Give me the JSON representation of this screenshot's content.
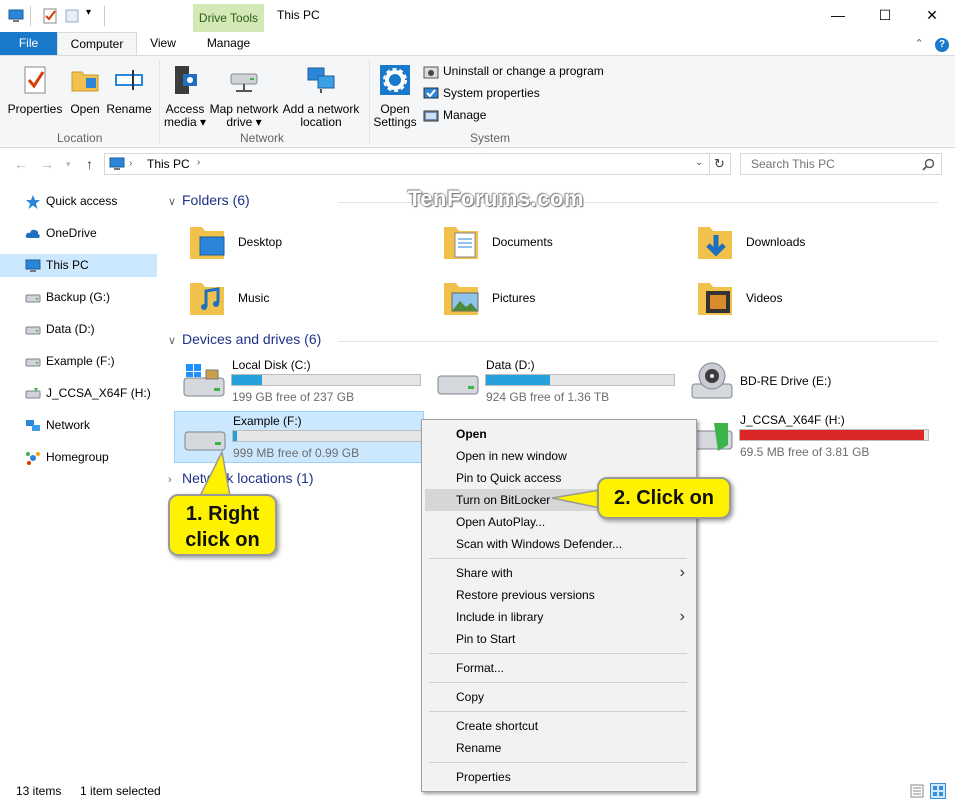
{
  "window": {
    "title": "This PC",
    "contextual_tab": "Drive Tools",
    "minimize": "—",
    "maximize": "☐",
    "close": "✕"
  },
  "tabs": {
    "file": "File",
    "computer": "Computer",
    "view": "View",
    "manage": "Manage"
  },
  "ribbon": {
    "location": {
      "label": "Location",
      "properties": "Properties",
      "open": "Open",
      "rename": "Rename"
    },
    "network": {
      "label": "Network",
      "access_media_1": "Access",
      "access_media_2": "media ▾",
      "map_drive_1": "Map network",
      "map_drive_2": "drive ▾",
      "add_location_1": "Add a network",
      "add_location_2": "location"
    },
    "system": {
      "label": "System",
      "open_settings_1": "Open",
      "open_settings_2": "Settings",
      "uninstall": "Uninstall or change a program",
      "system_properties": "System properties",
      "manage": "Manage"
    }
  },
  "address": {
    "path": "This PC",
    "search_placeholder": "Search This PC"
  },
  "nav": {
    "items": [
      {
        "label": "Quick access"
      },
      {
        "label": "OneDrive"
      },
      {
        "label": "This PC"
      },
      {
        "label": "Backup (G:)"
      },
      {
        "label": "Data (D:)"
      },
      {
        "label": "Example (F:)"
      },
      {
        "label": "J_CCSA_X64F (H:)"
      },
      {
        "label": "Network"
      },
      {
        "label": "Homegroup"
      }
    ]
  },
  "watermark": "TenForums.com",
  "folders": {
    "header": "Folders (6)",
    "items": [
      {
        "label": "Desktop"
      },
      {
        "label": "Documents"
      },
      {
        "label": "Downloads"
      },
      {
        "label": "Music"
      },
      {
        "label": "Pictures"
      },
      {
        "label": "Videos"
      }
    ]
  },
  "drives": {
    "header": "Devices and drives (6)",
    "items": [
      {
        "name": "Local Disk (C:)",
        "free": "199 GB free of 237 GB",
        "used_fraction": 0.16
      },
      {
        "name": "Data (D:)",
        "free": "924 GB free of 1.36 TB",
        "used_fraction": 0.34
      },
      {
        "name": "BD-RE Drive (E:)",
        "free": "",
        "used_fraction": null
      },
      {
        "name": "Example (F:)",
        "free": "999 MB free of 0.99 GB",
        "used_fraction": 0.02
      },
      {
        "name": "J_CCSA_X64F (H:)",
        "free": "69.5 MB free of 3.81 GB",
        "used_fraction": 0.98
      }
    ]
  },
  "network_locations": {
    "header": "Network locations (1)"
  },
  "status": {
    "items": "13 items",
    "selected": "1 item selected"
  },
  "context_menu": {
    "items": [
      "Open",
      "Open in new window",
      "Pin to Quick access",
      "Turn on BitLocker",
      "Open AutoPlay...",
      "Scan with Windows Defender...",
      "Share with",
      "Restore previous versions",
      "Include in library",
      "Pin to Start",
      "Format...",
      "Copy",
      "Create shortcut",
      "Rename",
      "Properties"
    ]
  },
  "callouts": {
    "step1_line1": "1. Right",
    "step1_line2": "click on",
    "step2": "2. Click on"
  },
  "colors": {
    "accent": "#1979ca",
    "selection": "#cce8ff",
    "drive_bar": "#26a0da",
    "drive_bar_full": "#da2626",
    "drive_tools": "#d2e9b5",
    "callout": "#fff200"
  }
}
